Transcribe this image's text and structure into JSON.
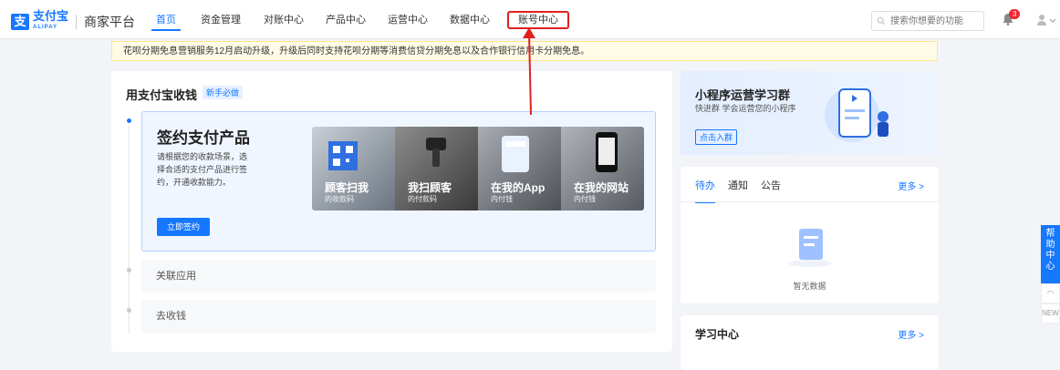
{
  "header": {
    "logo_mark": "支",
    "logo_text": "支付宝",
    "logo_sub": "ALIPAY",
    "brand": "商家平台",
    "nav": [
      {
        "label": "首页",
        "active": true
      },
      {
        "label": "资金管理"
      },
      {
        "label": "对账中心"
      },
      {
        "label": "产品中心"
      },
      {
        "label": "运营中心"
      },
      {
        "label": "数据中心"
      },
      {
        "label": "账号中心",
        "highlighted": true
      }
    ],
    "search_placeholder": "搜索你想要的功能",
    "notif_count": "3"
  },
  "notice": "花呗分期免息营销服务12月启动升级，升级后同时支持花呗分期等消费信贷分期免息以及合作银行信用卡分期免息。",
  "main": {
    "title": "用支付宝收钱",
    "tag": "新手必做",
    "step1": {
      "title": "签约支付产品",
      "desc": "请根据您的收款场景，选择合适的支付产品进行签约，开通收款能力。",
      "button": "立即签约",
      "products": [
        {
          "title": "顾客扫我",
          "sub": "的收款码"
        },
        {
          "title": "我扫顾客",
          "sub": "的付款码"
        },
        {
          "title": "在我的App",
          "sub": "内付钱"
        },
        {
          "title": "在我的网站",
          "sub": "内付钱"
        }
      ]
    },
    "step2": "关联应用",
    "step3": "去收钱"
  },
  "promo": {
    "title": "小程序运营学习群",
    "sub": "快进群 学会运营您的小程序",
    "button": "点击入群"
  },
  "todo": {
    "tabs": [
      "待办",
      "通知",
      "公告"
    ],
    "more": "更多 >",
    "empty": "暂无数据"
  },
  "learn": {
    "title": "学习中心",
    "more": "更多 >"
  },
  "help": {
    "label": "帮助中心"
  },
  "colors": {
    "accent": "#1677ff",
    "highlight": "#e02020"
  }
}
